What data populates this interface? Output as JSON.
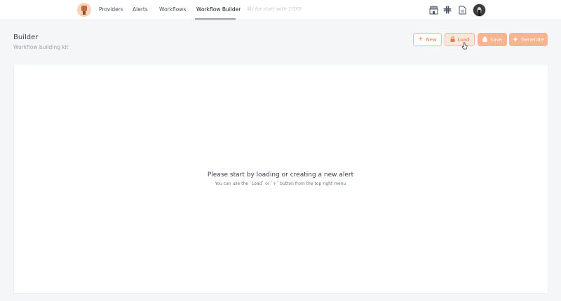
{
  "nav": {
    "items": [
      {
        "label": "Providers"
      },
      {
        "label": "Alerts"
      },
      {
        "label": "Workflows"
      },
      {
        "label": "Workflow Builder"
      }
    ],
    "hint": "⌘/ for start with 1OX5"
  },
  "header": {
    "title": "Builder",
    "subtitle": "Workflow building kit"
  },
  "toolbar": {
    "new_label": "New",
    "load_label": "Load",
    "save_label": "Save",
    "generate_label": "Generate"
  },
  "empty_state": {
    "title": "Please start by loading or creating a new alert",
    "subtitle": "You can use the `Load` or `+` button from the top right menu"
  },
  "colors": {
    "accent": "#f6b493",
    "accent_text": "#e07a55"
  }
}
